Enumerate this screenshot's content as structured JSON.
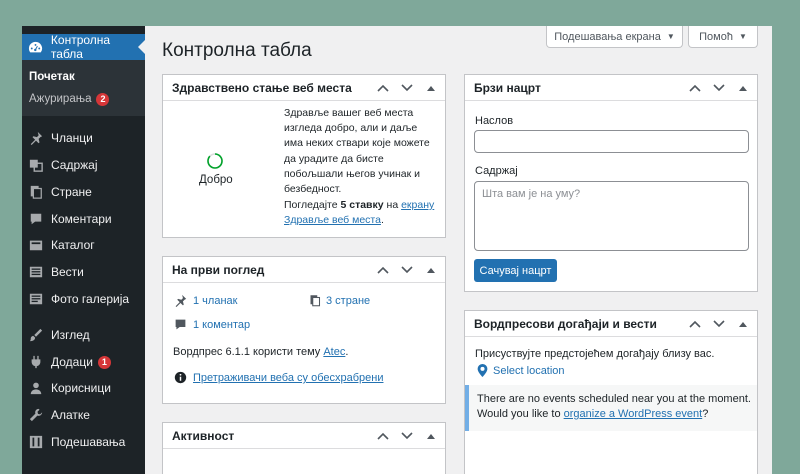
{
  "sidebar": {
    "dashboard_label": "Контролна табла",
    "submenu": {
      "home": "Почетак",
      "updates": "Ажурирања",
      "updates_count": "2"
    },
    "items": [
      {
        "label": "Чланци",
        "icon": "pin-icon"
      },
      {
        "label": "Садржај",
        "icon": "media-icon"
      },
      {
        "label": "Стране",
        "icon": "pages-icon"
      },
      {
        "label": "Коментари",
        "icon": "comments-icon"
      },
      {
        "label": "Каталог",
        "icon": "catalog-icon"
      },
      {
        "label": "Вести",
        "icon": "news-icon"
      },
      {
        "label": "Фото галерија",
        "icon": "gallery-icon"
      },
      {
        "label": "Изглед",
        "icon": "appearance-icon"
      },
      {
        "label": "Додаци",
        "icon": "plugins-icon",
        "badge": "1"
      },
      {
        "label": "Корисници",
        "icon": "users-icon"
      },
      {
        "label": "Алатке",
        "icon": "tools-icon"
      },
      {
        "label": "Подешавања",
        "icon": "settings-icon"
      }
    ]
  },
  "header": {
    "screen_options": "Подешавања екрана",
    "help": "Помоћ",
    "title": "Контролна табла"
  },
  "site_health": {
    "title": "Здравствено стање веб места",
    "status": "Добро",
    "description": "Здравље вашег веб места изгледа добро, али и даље има неких ствари које можете да урадите да бисте побољшали његов учинак и безбедност.",
    "review_prefix": "Погледајте ",
    "review_count": "5 ставку",
    "review_mid": " на ",
    "review_link": "екрану Здравље веб места",
    "review_suffix": "."
  },
  "at_a_glance": {
    "title": "На први поглед",
    "posts": "1 чланак",
    "pages": "3 стране",
    "comments": "1 коментар",
    "theme_text": "Вордпрес 6.1.1 користи тему ",
    "theme_name": "Atec",
    "theme_suffix": ".",
    "search_engines": "Претраживачи веба су обесхрабрени"
  },
  "activity": {
    "title": "Активност"
  },
  "quick_draft": {
    "title": "Брзи нацрт",
    "title_label": "Наслов",
    "content_label": "Садржај",
    "content_placeholder": "Шта вам је на уму?",
    "save_button": "Сачувај нацрт"
  },
  "events": {
    "title": "Вордпресови догађаји и вести",
    "intro": "Присуствујте предстојећем догађају близу вас.",
    "select_location": "Select location",
    "no_events": "There are no events scheduled near you at the moment.",
    "would_you": "Would you like to ",
    "organize_link": "organize a WordPress event",
    "question": "?"
  },
  "colors": {
    "accent": "#2271b1",
    "sidebar": "#1d2327",
    "badge": "#d63638",
    "health_ok": "#00a32a"
  }
}
